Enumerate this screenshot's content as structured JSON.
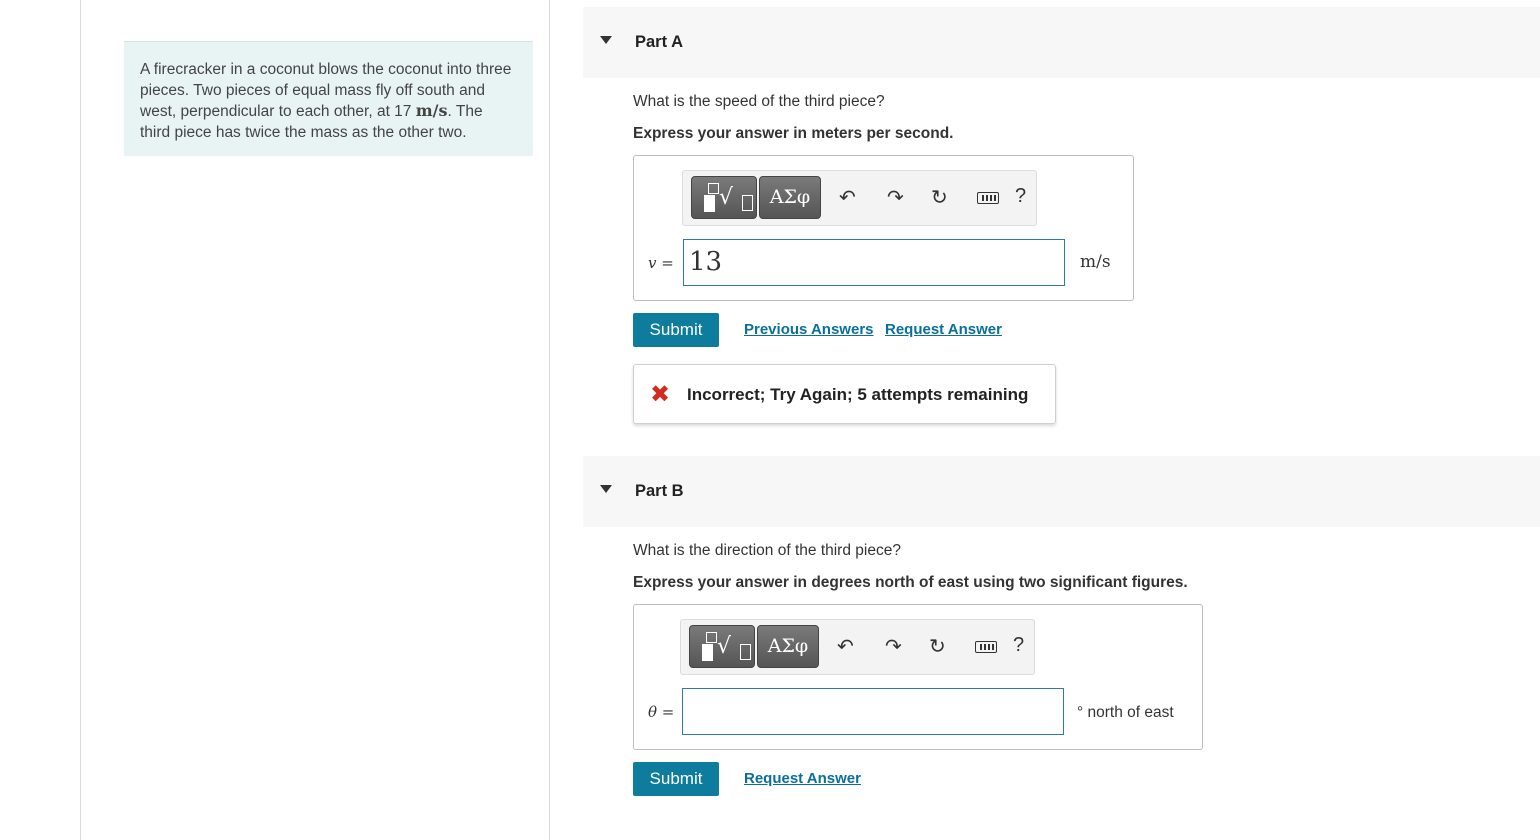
{
  "problem": {
    "text_before": "A firecracker in a coconut blows the coconut into three pieces. Two pieces of equal mass fly off south and west, perpendicular to each other, at 17",
    "unit": "m/s",
    "text_after_unit": ".",
    "text_after": "The third piece has twice the mass as the other two."
  },
  "partA": {
    "title": "Part A",
    "question": "What is the speed of the third piece?",
    "instruction": "Express your answer in meters per second.",
    "toolbar": {
      "greek_label": "ΑΣφ",
      "help_label": "?"
    },
    "var_label": "v =",
    "input_value": "13",
    "unit": "m/s",
    "submit_label": "Submit",
    "previous_answers_label": "Previous Answers",
    "request_answer_label": "Request Answer",
    "feedback": "Incorrect; Try Again; 5 attempts remaining",
    "feedback_icon": "✖"
  },
  "partB": {
    "title": "Part B",
    "question": "What is the direction of the third piece?",
    "instruction": "Express your answer in degrees north of east using two significant figures.",
    "toolbar": {
      "greek_label": "ΑΣφ",
      "help_label": "?"
    },
    "var_label": "θ =",
    "input_value": "",
    "unit": "° north of east",
    "submit_label": "Submit",
    "request_answer_label": "Request Answer"
  },
  "colors": {
    "accent": "#0e7c9c",
    "link": "#0a6f9a",
    "error": "#d32b1e",
    "problem_bg": "#e8f4f4"
  }
}
